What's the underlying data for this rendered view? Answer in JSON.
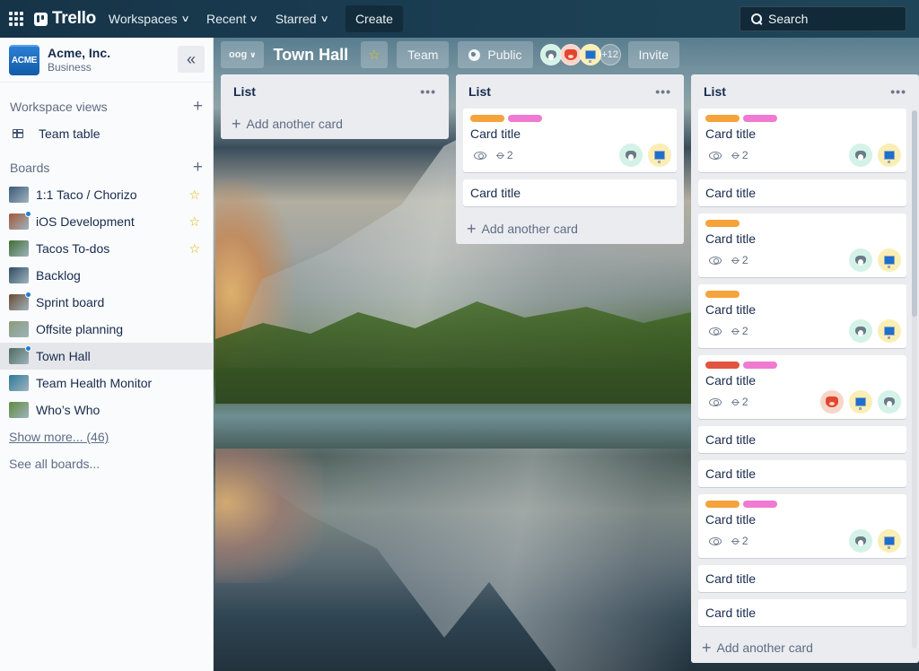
{
  "app": {
    "name": "Trello"
  },
  "topbar": {
    "menus": [
      "Workspaces",
      "Recent",
      "Starred"
    ],
    "create_label": "Create",
    "search_placeholder": "Search"
  },
  "workspace": {
    "logo_text": "ACME",
    "name": "Acme, Inc.",
    "plan": "Business",
    "collapse_icon": "«"
  },
  "sidebar": {
    "views_heading": "Workspace views",
    "views": [
      {
        "label": "Team table",
        "icon": "table-icon"
      }
    ],
    "boards_heading": "Boards",
    "boards": [
      {
        "label": "1:1 Taco / Chorizo",
        "starred": true,
        "unread": false,
        "active": false,
        "thumb": "#3c5a78"
      },
      {
        "label": "iOS Development",
        "starred": true,
        "unread": true,
        "active": false,
        "thumb": "#a0583a"
      },
      {
        "label": "Tacos To-dos",
        "starred": true,
        "unread": false,
        "active": false,
        "thumb": "#3f6e32"
      },
      {
        "label": "Backlog",
        "starred": false,
        "unread": false,
        "active": false,
        "thumb": "#2f4b62"
      },
      {
        "label": "Sprint board",
        "starred": false,
        "unread": true,
        "active": false,
        "thumb": "#6a4a34"
      },
      {
        "label": "Offsite planning",
        "starred": false,
        "unread": false,
        "active": false,
        "thumb": "#8a9a78"
      },
      {
        "label": "Town Hall",
        "starred": false,
        "unread": true,
        "active": true,
        "thumb": "#4d6a5e"
      },
      {
        "label": "Team Health Monitor",
        "starred": false,
        "unread": false,
        "active": false,
        "thumb": "#2d7a9a"
      },
      {
        "label": "Who’s Who",
        "starred": false,
        "unread": false,
        "active": false,
        "thumb": "#5f8a3e"
      }
    ],
    "show_more": "Show more... (46)",
    "see_all": "See all boards..."
  },
  "board": {
    "view_switch": "oog",
    "title": "Town Hall",
    "starred": true,
    "team_label": "Team",
    "visibility_label": "Public",
    "members": [
      "husky",
      "fox",
      "computer"
    ],
    "members_more": "+12",
    "invite_label": "Invite"
  },
  "colors": {
    "label_orange": "#f5a33b",
    "label_pink": "#f07ad1",
    "label_red": "#e2543f",
    "star": "#e2b203",
    "unread_dot": "#1e7ed6"
  },
  "lists": [
    {
      "title": "List",
      "menu": "•••",
      "add_card": "Add another card",
      "cards": []
    },
    {
      "title": "List",
      "menu": "•••",
      "add_card": "Add another card",
      "cards": [
        {
          "title": "Card title",
          "labels": [
            "orange",
            "pink"
          ],
          "watch": true,
          "attachments": "2",
          "members": [
            "husky",
            "computer"
          ]
        },
        {
          "title": "Card title"
        }
      ]
    },
    {
      "title": "List",
      "menu": "•••",
      "add_card": "Add another card",
      "cards": [
        {
          "title": "Card title",
          "labels": [
            "orange",
            "pink"
          ],
          "watch": true,
          "attachments": "2",
          "members": [
            "husky",
            "computer"
          ]
        },
        {
          "title": "Card title"
        },
        {
          "title": "Card title",
          "labels": [
            "orange"
          ],
          "watch": true,
          "attachments": "2",
          "members": [
            "husky",
            "computer"
          ]
        },
        {
          "title": "Card title",
          "labels": [
            "orange"
          ],
          "watch": true,
          "attachments": "2",
          "members": [
            "husky",
            "computer"
          ]
        },
        {
          "title": "Card title",
          "labels": [
            "red",
            "pink"
          ],
          "watch": true,
          "attachments": "2",
          "members": [
            "fox",
            "computer",
            "husky"
          ]
        },
        {
          "title": "Card title"
        },
        {
          "title": "Card title"
        },
        {
          "title": "Card title",
          "labels": [
            "orange",
            "pink"
          ],
          "watch": true,
          "attachments": "2",
          "members": [
            "husky",
            "computer"
          ]
        },
        {
          "title": "Card title"
        },
        {
          "title": "Card title"
        },
        {
          "title": "",
          "labels": [
            "orange",
            "pink"
          ],
          "partial": true
        }
      ]
    }
  ]
}
